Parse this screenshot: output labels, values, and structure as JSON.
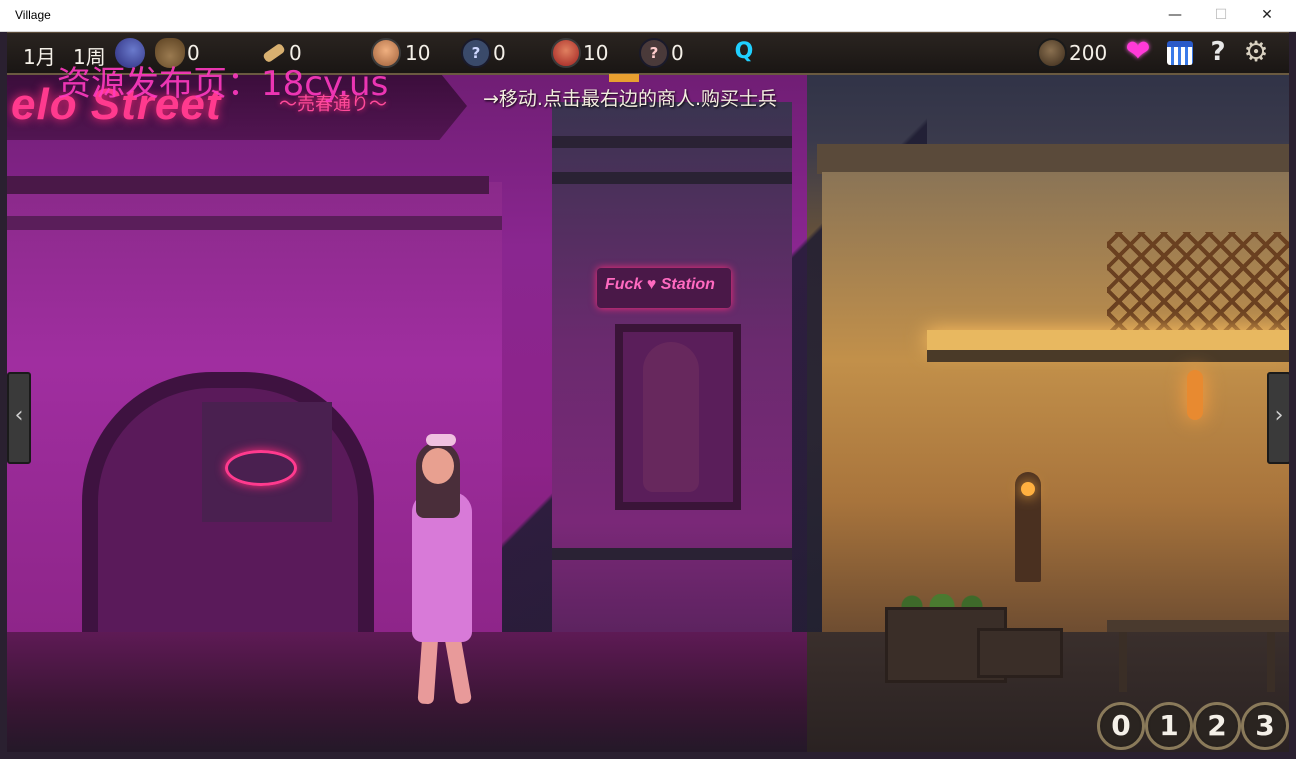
{
  "window": {
    "title": "Village",
    "minimize_label": "—",
    "maximize_label": "☐",
    "close_label": "✕"
  },
  "hud": {
    "month": "1月",
    "week": "1周",
    "sack_count": "0",
    "scroll_count": "0",
    "soldier_a_count": "10",
    "unknown_a_count": "0",
    "soldier_b_count": "10",
    "unknown_b_count": "0",
    "coin_count": "200",
    "icons": {
      "moon": "moon-icon",
      "sack": "sack-icon",
      "scroll": "scroll-icon",
      "soldier_a": "soldier-portrait-icon",
      "unknown": "question-icon",
      "soldier_b": "redhead-portrait-icon",
      "search": "search-icon",
      "coin": "coin-icon",
      "heart": "heart-icon",
      "calendar": "calendar-icon",
      "help": "help-icon",
      "settings": "gear-icon"
    },
    "unknown_glyph": "?",
    "search_glyph": "Q",
    "heart_glyph": "❤",
    "help_glyph": "?",
    "gear_glyph": "⚙"
  },
  "watermark": "资源发布页：18cy.us",
  "instruction": "→移动.点击最右边的商人.购买士兵",
  "scene": {
    "neon_sign_text": "elo Street",
    "neon_sign_subtext": "～売春通り～",
    "station_sign_text": "Fuck ♥ Station"
  },
  "navigation": {
    "left_arrow": "‹",
    "right_arrow": "›"
  },
  "speed_buttons": [
    "0",
    "1",
    "2",
    "3"
  ],
  "colors": {
    "neon_pink": "#ff3a8e",
    "watermark": "#ff3ac0",
    "search_cyan": "#20d0ff",
    "heart_magenta": "#ff3ad8"
  }
}
